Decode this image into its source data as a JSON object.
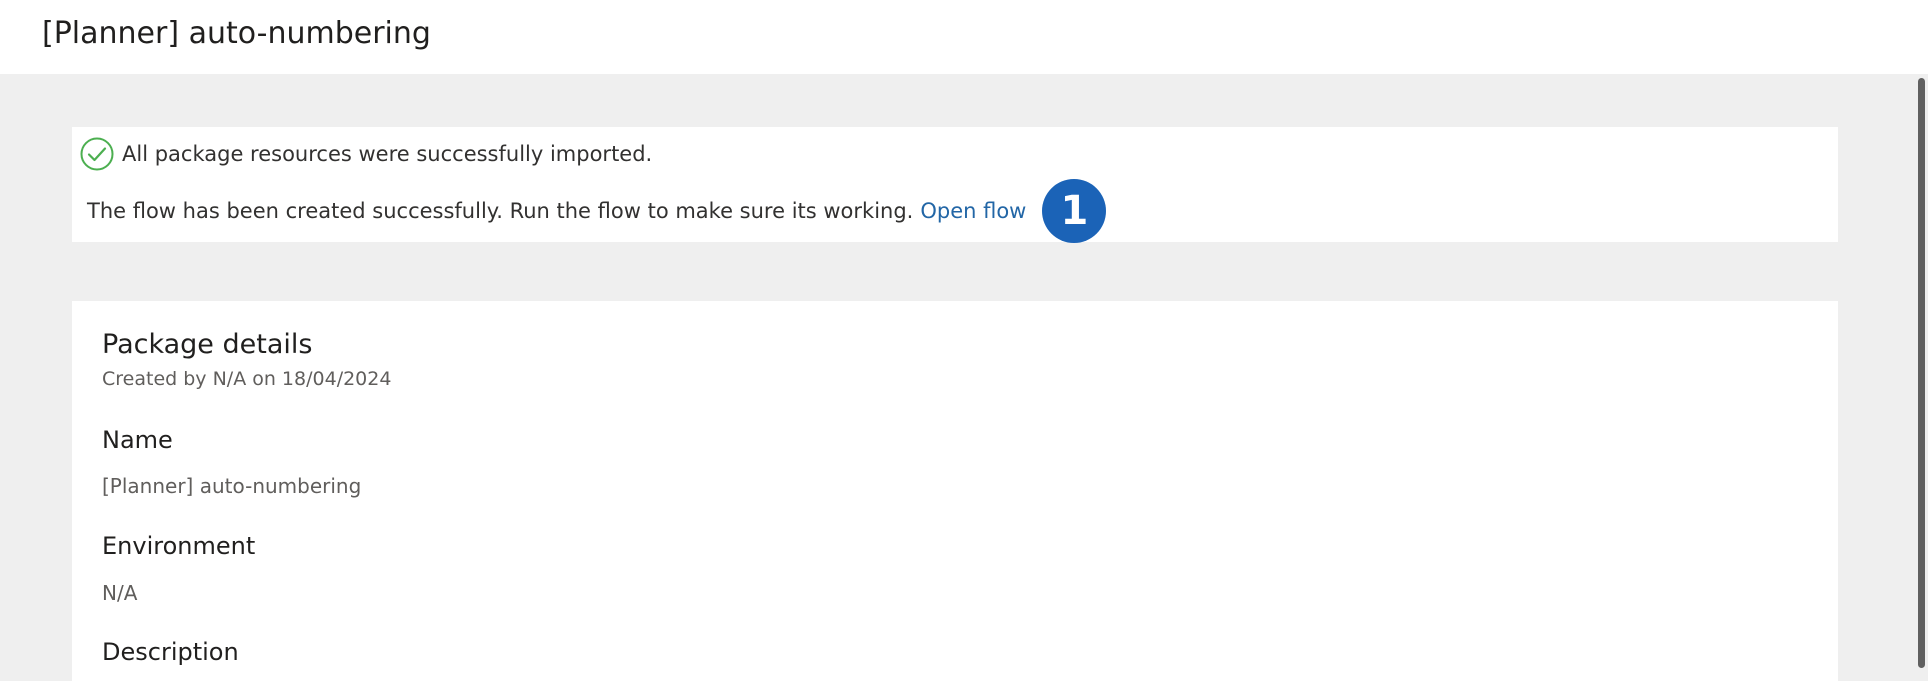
{
  "header": {
    "title": "[Planner] auto-numbering"
  },
  "notice": {
    "success_icon": "check-circle-icon",
    "success_color": "#4caf50",
    "success_message": "All package resources were successfully imported.",
    "flow_message": "The flow has been created successfully. Run the flow to make sure its working.",
    "open_flow_label": "Open flow",
    "step_badge": "1",
    "badge_color": "#1b63b7"
  },
  "details": {
    "title": "Package details",
    "subtitle": "Created by N/A on 18/04/2024",
    "fields": [
      {
        "label": "Name",
        "value": "[Planner] auto-numbering"
      },
      {
        "label": "Environment",
        "value": "N/A"
      },
      {
        "label": "Description",
        "value": ""
      }
    ]
  }
}
